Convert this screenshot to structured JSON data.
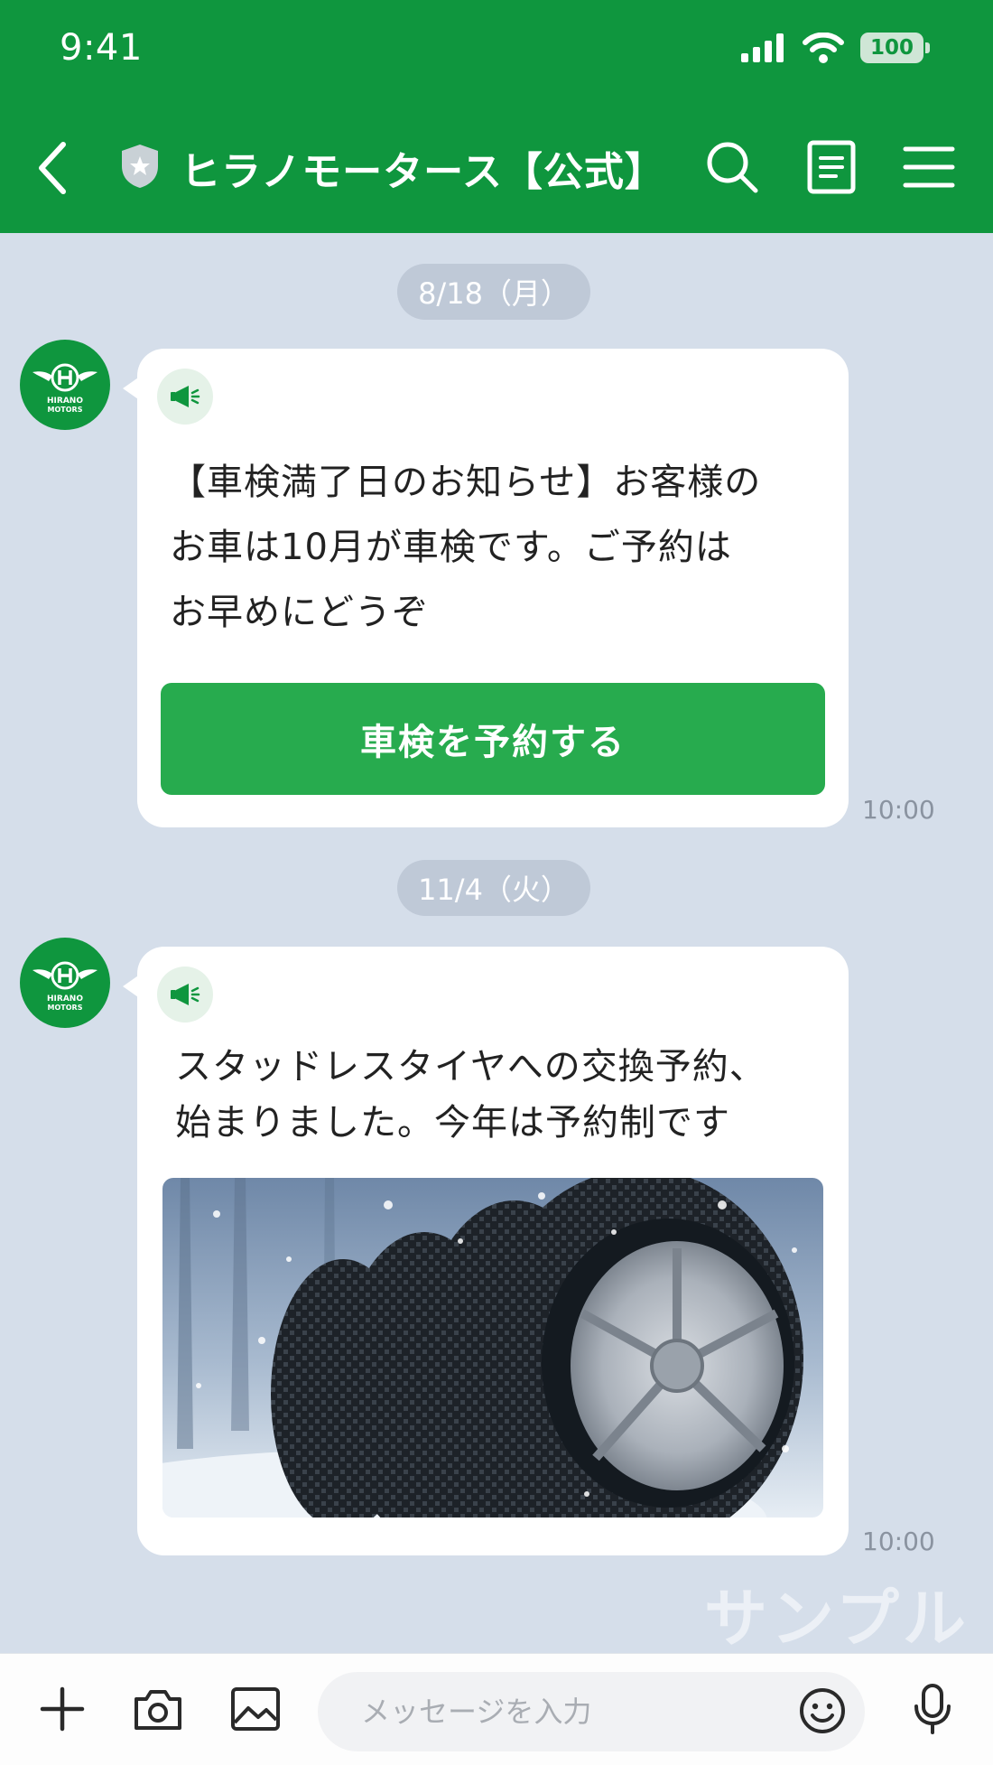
{
  "status_bar": {
    "time": "9:41",
    "battery": "100"
  },
  "header": {
    "title": "ヒラノモータース【公式】",
    "icons": [
      "chevron-left-icon",
      "shield-icon",
      "search-icon",
      "notes-icon",
      "menu-icon"
    ]
  },
  "messages": [
    {
      "date": "8/18（月）",
      "avatar_text": [
        "HIRANO",
        "MOTORS"
      ],
      "text_lines": [
        "【車検満了日のお知らせ】お客様の",
        "お車は10月が車検です。ご予約は",
        "お早めにどうぞ"
      ],
      "button_label": "車検を予約する",
      "time": "10:00"
    },
    {
      "date": "11/4（火）",
      "avatar_text": [
        "HIRANO",
        "MOTORS"
      ],
      "text_lines": [
        "スタッドレスタイヤへの交換予約、",
        "始まりました。今年は予約制です"
      ],
      "image": "winter-tires-photo",
      "time": "10:00"
    }
  ],
  "watermark": "サンプル",
  "input_bar": {
    "placeholder": "メッセージを入力",
    "icons": [
      "plus-icon",
      "camera-icon",
      "image-icon",
      "emoji-icon",
      "mic-icon"
    ]
  },
  "colors": {
    "brand_green": "#0f963e",
    "button_green": "#27ab4e",
    "chat_background": "#d5deea"
  }
}
